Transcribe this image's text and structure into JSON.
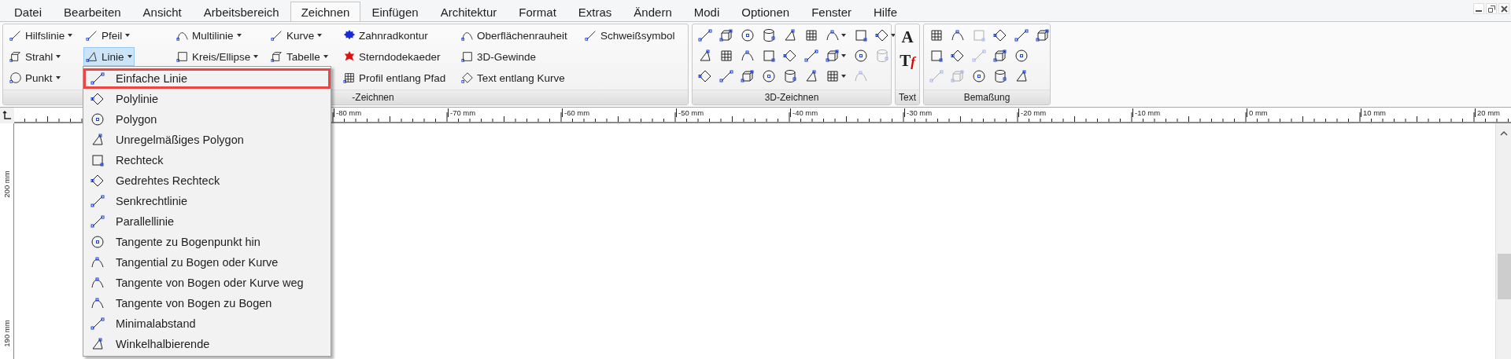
{
  "menu": [
    {
      "label": "Datei",
      "selected": false
    },
    {
      "label": "Bearbeiten",
      "selected": false
    },
    {
      "label": "Ansicht",
      "selected": false
    },
    {
      "label": "Arbeitsbereich",
      "selected": false
    },
    {
      "label": "Zeichnen",
      "selected": true
    },
    {
      "label": "Einfügen",
      "selected": false
    },
    {
      "label": "Architektur",
      "selected": false
    },
    {
      "label": "Format",
      "selected": false
    },
    {
      "label": "Extras",
      "selected": false
    },
    {
      "label": "Ändern",
      "selected": false
    },
    {
      "label": "Modi",
      "selected": false
    },
    {
      "label": "Optionen",
      "selected": false
    },
    {
      "label": "Fenster",
      "selected": false
    },
    {
      "label": "Hilfe",
      "selected": false
    }
  ],
  "draw_group": {
    "label": "-Zeichnen",
    "columns": [
      [
        {
          "label": "Hilfslinie",
          "dropdown": true,
          "expanded": false
        },
        {
          "label": "Strahl",
          "dropdown": true,
          "expanded": false
        },
        {
          "label": "Punkt",
          "dropdown": true,
          "expanded": false
        }
      ],
      [
        {
          "label": "Pfeil",
          "dropdown": true,
          "expanded": false
        },
        {
          "label": "Linie",
          "dropdown": true,
          "expanded": true
        }
      ],
      [
        {
          "label": "Multilinie",
          "dropdown": true,
          "expanded": false
        },
        {
          "label": "Kreis/Ellipse",
          "dropdown": true,
          "expanded": false
        }
      ],
      [
        {
          "label": "Kurve",
          "dropdown": true,
          "expanded": false
        },
        {
          "label": "Tabelle",
          "dropdown": true,
          "expanded": false
        }
      ],
      [
        {
          "label": "Zahnradkontur",
          "dropdown": false,
          "expanded": false
        },
        {
          "label": "Sterndodekaeder",
          "dropdown": false,
          "expanded": false
        },
        {
          "label": "Profil entlang Pfad",
          "dropdown": false,
          "expanded": false
        }
      ],
      [
        {
          "label": "Oberflächenrauheit",
          "dropdown": false,
          "expanded": false
        },
        {
          "label": "3D-Gewinde",
          "dropdown": false,
          "expanded": false
        },
        {
          "label": "Text entlang Kurve",
          "dropdown": false,
          "expanded": false
        }
      ],
      [
        {
          "label": "Schweißsymbol",
          "dropdown": false,
          "expanded": false
        }
      ]
    ]
  },
  "group_3d": {
    "label": "3D-Zeichnen",
    "rows": [
      [
        {
          "disabled": false,
          "dropdown": false
        },
        {
          "disabled": false,
          "dropdown": false
        },
        {
          "disabled": false,
          "dropdown": false
        },
        {
          "disabled": false,
          "dropdown": false
        },
        {
          "disabled": false,
          "dropdown": false
        },
        {
          "disabled": false,
          "dropdown": false
        },
        {
          "disabled": false,
          "dropdown": true
        },
        {
          "disabled": false,
          "dropdown": false
        },
        {
          "disabled": false,
          "dropdown": true
        }
      ],
      [
        {
          "disabled": false,
          "dropdown": false
        },
        {
          "disabled": false,
          "dropdown": false
        },
        {
          "disabled": false,
          "dropdown": false
        },
        {
          "disabled": false,
          "dropdown": false
        },
        {
          "disabled": false,
          "dropdown": false
        },
        {
          "disabled": false,
          "dropdown": false
        },
        {
          "disabled": false,
          "dropdown": true
        },
        {
          "disabled": false,
          "dropdown": false
        },
        {
          "disabled": true,
          "dropdown": false
        }
      ],
      [
        {
          "disabled": false,
          "dropdown": false
        },
        {
          "disabled": false,
          "dropdown": false
        },
        {
          "disabled": false,
          "dropdown": false
        },
        {
          "disabled": false,
          "dropdown": false
        },
        {
          "disabled": false,
          "dropdown": false
        },
        {
          "disabled": false,
          "dropdown": false
        },
        {
          "disabled": false,
          "dropdown": true
        },
        {
          "disabled": true,
          "dropdown": false
        }
      ]
    ]
  },
  "text_group": {
    "label": "Text",
    "buttons": [
      {
        "glyph": "A"
      },
      {
        "glyph": "T",
        "accent": "f"
      }
    ]
  },
  "dim_group": {
    "label": "Bemaßung",
    "rows": [
      [
        {
          "disabled": false
        },
        {
          "disabled": false
        },
        {
          "disabled": true
        },
        {
          "disabled": false
        },
        {
          "disabled": false
        },
        {
          "disabled": false
        }
      ],
      [
        {
          "disabled": false
        },
        {
          "disabled": false
        },
        {
          "disabled": true
        },
        {
          "disabled": false
        },
        {
          "disabled": false
        }
      ],
      [
        {
          "disabled": true
        },
        {
          "disabled": true
        },
        {
          "disabled": false
        },
        {
          "disabled": false
        },
        {
          "disabled": false
        }
      ]
    ]
  },
  "ruler": {
    "labels": [
      "-80 mm",
      "-70 mm",
      "-60 mm",
      "-50 mm",
      "-40 mm",
      "-30 mm",
      "-20 mm",
      "-10 mm",
      "0 mm",
      "10 mm",
      "20 mm"
    ],
    "vertical_labels": [
      "200 mm",
      "190 mm"
    ]
  },
  "dropdown": {
    "items": [
      {
        "label": "Einfache Linie",
        "selected": true
      },
      {
        "label": "Polylinie",
        "selected": false
      },
      {
        "label": "Polygon",
        "selected": false
      },
      {
        "label": "Unregelmäßiges Polygon",
        "selected": false
      },
      {
        "label": "Rechteck",
        "selected": false
      },
      {
        "label": "Gedrehtes Rechteck",
        "selected": false
      },
      {
        "label": "Senkrechtlinie",
        "selected": false
      },
      {
        "label": "Parallellinie",
        "selected": false
      },
      {
        "label": "Tangente zu Bogenpunkt hin",
        "selected": false
      },
      {
        "label": "Tangential zu Bogen oder Kurve",
        "selected": false
      },
      {
        "label": "Tangente von Bogen oder Kurve weg",
        "selected": false
      },
      {
        "label": "Tangente von Bogen zu Bogen",
        "selected": false
      },
      {
        "label": "Minimalabstand",
        "selected": false
      },
      {
        "label": "Winkelhalbierende",
        "selected": false
      }
    ]
  }
}
